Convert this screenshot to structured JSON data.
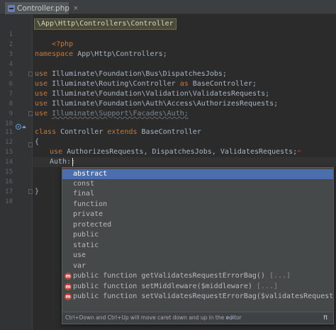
{
  "tab": {
    "file_name": "Controller.php",
    "close_glyph": "×"
  },
  "breadcrumb": "\\App\\Http\\Controllers\\Controller",
  "gutter": {
    "line_numbers": [
      "1",
      "2",
      "3",
      "4",
      "5",
      "6",
      "7",
      "8",
      "9",
      "10",
      "11",
      "12",
      "13",
      "14",
      "15",
      "16",
      "17",
      "18"
    ]
  },
  "code": {
    "l1": "<?php",
    "l3_kw": "namespace",
    "l3_rest": " App\\Http\\Controllers;",
    "l5_kw": "use",
    "l5_rest": " Illuminate\\Foundation\\Bus\\DispatchesJobs;",
    "l6_kw": "use",
    "l6_mid": " Illuminate\\Routing\\Controller ",
    "l6_as": "as",
    "l6_rest": " BaseController;",
    "l7_kw": "use",
    "l7_rest": " Illuminate\\Foundation\\Validation\\ValidatesRequests;",
    "l8_kw": "use",
    "l8_rest": " Illuminate\\Foundation\\Auth\\Access\\AuthorizesRequests;",
    "l9_kw": "use",
    "l9_rest": "Illuminate\\Support\\Facades\\Auth;",
    "l11_kw": "class",
    "l11_name": " Controller ",
    "l11_ext": "extends",
    "l11_base": " BaseController",
    "l12": "{",
    "l13_kw": "use",
    "l13_rest": " AuthorizesRequests, DispatchesJobs, ValidatesRequests;",
    "l15": "Auth::",
    "l17": "}"
  },
  "completion": {
    "items": [
      {
        "label": "abstract",
        "selected": true
      },
      {
        "label": "const"
      },
      {
        "label": "final"
      },
      {
        "label": "function"
      },
      {
        "label": "private"
      },
      {
        "label": "protected"
      },
      {
        "label": "public"
      },
      {
        "label": "static"
      },
      {
        "label": "use"
      },
      {
        "label": "var"
      }
    ],
    "methods": [
      {
        "icon": "m",
        "label": "public function getValidatesRequestErrorBag()",
        "params": " [...]"
      },
      {
        "icon": "m",
        "label": "public function setMiddleware($middleware)",
        "params": " [...]"
      },
      {
        "icon": "m",
        "label": "public function setValidatesRequestErrorBag($validatesRequestErr…",
        "params": ""
      }
    ],
    "footer_hint": "Ctrl+Down and Ctrl+Up will move caret down and up in the editor",
    "footer_link": ">>",
    "footer_pi": "π"
  },
  "colors": {
    "background": "#2b2b2b",
    "keyword": "#cc7832",
    "text": "#a9b7c6",
    "selection": "#4b6eaf",
    "method_icon": "#c0473b"
  }
}
